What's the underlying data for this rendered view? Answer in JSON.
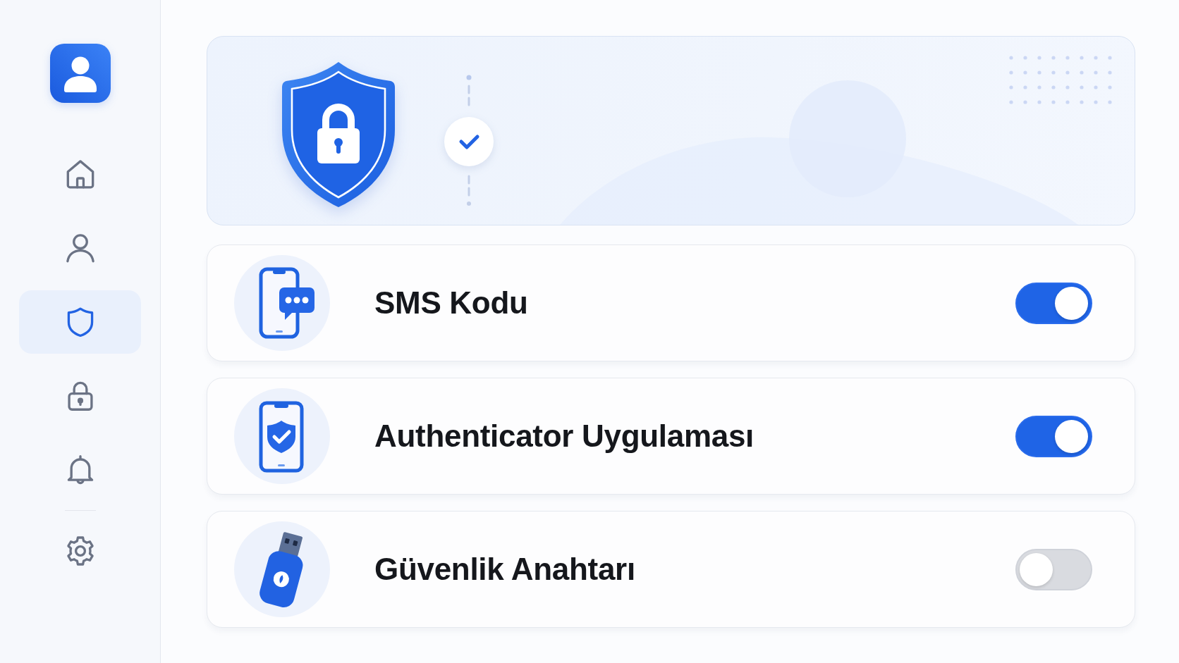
{
  "sidebar": {
    "nav_items": [
      {
        "kind": "home",
        "selected": false
      },
      {
        "kind": "profile",
        "selected": false
      },
      {
        "kind": "security",
        "selected": true
      },
      {
        "kind": "lock",
        "selected": false
      },
      {
        "kind": "notifications",
        "selected": false
      }
    ],
    "footer_items": [
      {
        "kind": "settings",
        "selected": false
      }
    ]
  },
  "methods": [
    {
      "kind": "sms",
      "label": "SMS Kodu",
      "on": true
    },
    {
      "kind": "authenticator",
      "label": "Authenticator Uygulaması",
      "on": true
    },
    {
      "kind": "security_key",
      "label": "Güvenlik Anahtarı",
      "on": false
    }
  ]
}
